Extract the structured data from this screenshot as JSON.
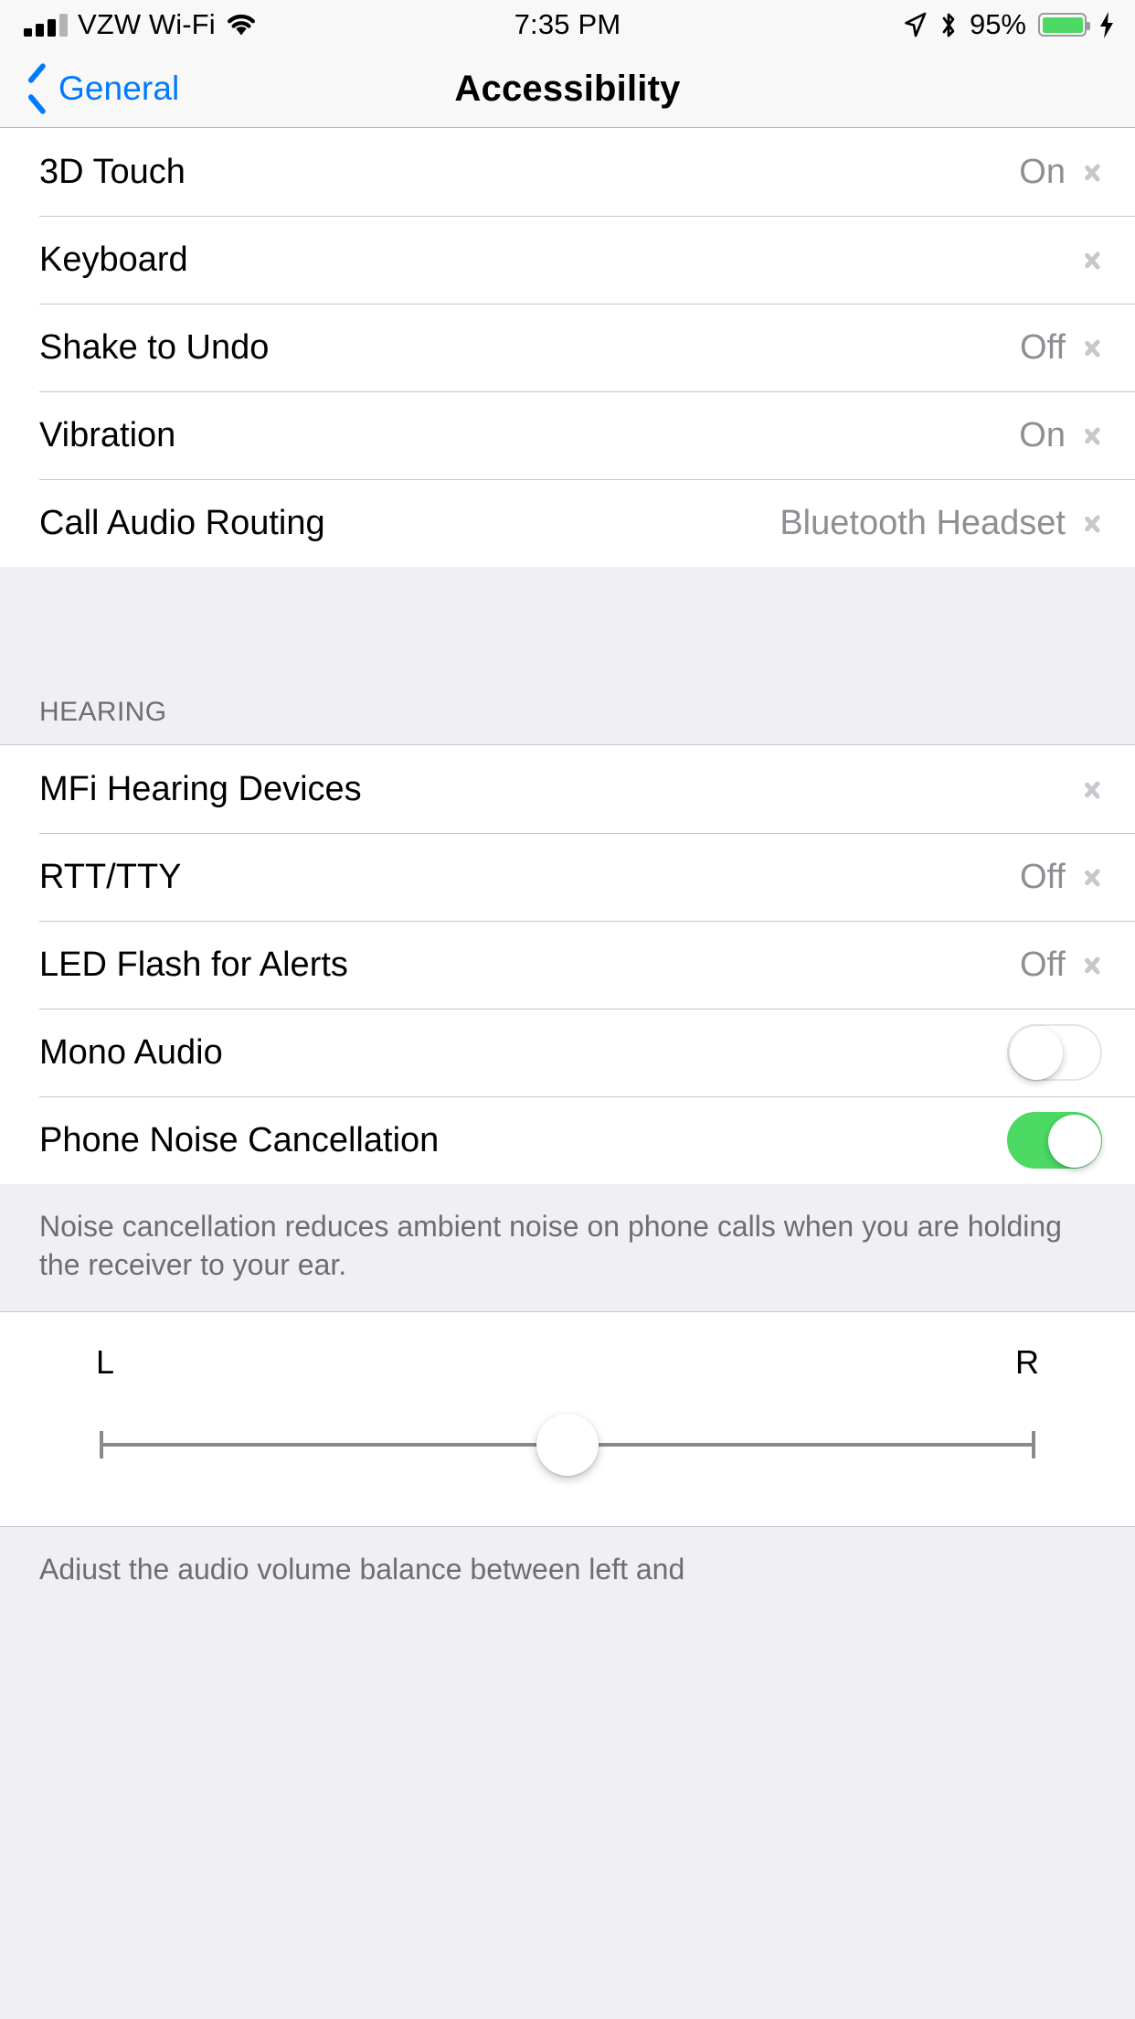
{
  "status_bar": {
    "carrier": "VZW Wi-Fi",
    "signal_bars_filled": 3,
    "signal_bars_total": 4,
    "wifi_icon": "wifi-icon",
    "time": "7:35 PM",
    "location_icon": "location-arrow-icon",
    "bluetooth_icon": "bluetooth-icon",
    "battery_percent": "95%",
    "battery_level": 95,
    "battery_color": "#4CD964",
    "charging_icon": "lightning-bolt-icon"
  },
  "nav_bar": {
    "back_label": "General",
    "back_icon": "chevron-left-icon",
    "title": "Accessibility",
    "accent_color": "#007AFF"
  },
  "group1": {
    "rows": [
      {
        "label": "3D Touch",
        "value": "On",
        "type": "disclosure"
      },
      {
        "label": "Keyboard",
        "value": "",
        "type": "disclosure"
      },
      {
        "label": "Shake to Undo",
        "value": "Off",
        "type": "disclosure"
      },
      {
        "label": "Vibration",
        "value": "On",
        "type": "disclosure"
      },
      {
        "label": "Call Audio Routing",
        "value": "Bluetooth Headset",
        "type": "disclosure"
      }
    ]
  },
  "hearing_section": {
    "header": "HEARING",
    "rows": [
      {
        "label": "MFi Hearing Devices",
        "value": "",
        "type": "disclosure"
      },
      {
        "label": "RTT/TTY",
        "value": "Off",
        "type": "disclosure"
      },
      {
        "label": "LED Flash for Alerts",
        "value": "Off",
        "type": "disclosure"
      },
      {
        "label": "Mono Audio",
        "value": "",
        "type": "toggle",
        "on": false
      },
      {
        "label": "Phone Noise Cancellation",
        "value": "",
        "type": "toggle",
        "on": true
      }
    ],
    "footer": "Noise cancellation reduces ambient noise on phone calls when you are holding the receiver to your ear."
  },
  "balance_slider": {
    "left_label": "L",
    "right_label": "R",
    "value": 50,
    "min": 0,
    "max": 100,
    "footer": "Adjust the audio volume balance between left and"
  },
  "colors": {
    "toggle_on": "#4CD964",
    "group_bg": "#FFFFFF",
    "page_bg": "#EFEFF4",
    "secondary_text": "#8E8E93"
  }
}
